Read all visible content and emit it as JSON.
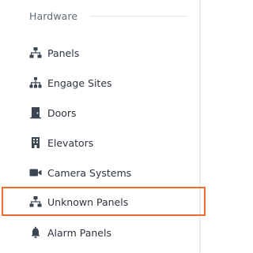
{
  "sidebar": {
    "section_title": "Hardware",
    "items": [
      {
        "label": "Panels",
        "icon": "network-icon"
      },
      {
        "label": "Engage Sites",
        "icon": "sitemap-icon"
      },
      {
        "label": "Doors",
        "icon": "door-icon"
      },
      {
        "label": "Elevators",
        "icon": "building-icon"
      },
      {
        "label": "Camera Systems",
        "icon": "video-camera-icon"
      },
      {
        "label": "Unknown Panels",
        "icon": "network-icon"
      },
      {
        "label": "Alarm Panels",
        "icon": "bell-icon"
      }
    ],
    "highlighted_item": "Unknown Panels",
    "highlight_color": "#ef6c2f",
    "icon_color": "#3b4552"
  }
}
